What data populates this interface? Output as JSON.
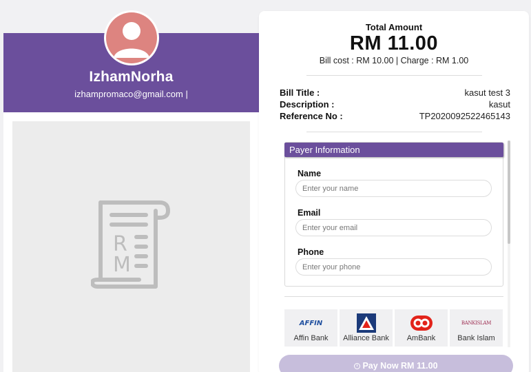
{
  "profile": {
    "name": "IzhamNorha",
    "email": "izhampromaco@gmail.com |",
    "avatar_icon": "user-avatar-icon",
    "receipt_icon": "receipt-rm-icon"
  },
  "summary": {
    "total_label": "Total Amount",
    "total_amount": "RM 11.00",
    "breakdown": "Bill cost : RM 10.00 | Charge : RM 1.00"
  },
  "details": [
    {
      "key": "Bill Title :",
      "value": "kasut test 3"
    },
    {
      "key": "Description :",
      "value": "kasut"
    },
    {
      "key": "Reference No :",
      "value": "TP2020092522465143"
    }
  ],
  "payer": {
    "header": "Payer Information",
    "name_label": "Name",
    "name_placeholder": "Enter your name",
    "email_label": "Email",
    "email_placeholder": "Enter your email",
    "phone_label": "Phone",
    "phone_placeholder": "Enter your phone"
  },
  "banks": [
    {
      "name": "Affin Bank",
      "logo_text": "AFFIN",
      "logo_color": "#1f4f9f"
    },
    {
      "name": "Alliance Bank",
      "logo_color": "#1b3a7a"
    },
    {
      "name": "AmBank",
      "logo_color": "#e2231a"
    },
    {
      "name": "Bank Islam",
      "logo_text": "BANKISLAM",
      "logo_color": "#9c2a4f"
    }
  ],
  "pay_button": {
    "label": "Pay Now RM 11.00"
  },
  "colors": {
    "brand": "#6b4f9c",
    "button": "#c7bedc",
    "avatar": "#dd8480"
  }
}
